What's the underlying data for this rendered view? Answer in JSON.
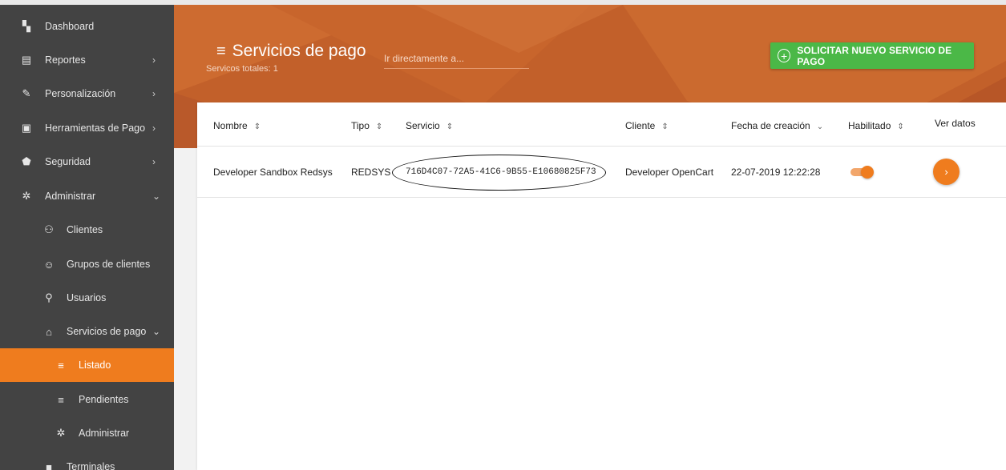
{
  "sidebar": {
    "items": [
      {
        "label": "Dashboard",
        "icon": "dashboard-icon",
        "glyph": "▚"
      },
      {
        "label": "Reportes",
        "icon": "clipboard-icon",
        "glyph": "▤",
        "chevron": "›"
      },
      {
        "label": "Personalización",
        "icon": "brush-icon",
        "glyph": "✎",
        "chevron": "›"
      },
      {
        "label": "Herramientas de Pago",
        "icon": "payment-icon",
        "glyph": "▣",
        "chevron": "›"
      },
      {
        "label": "Seguridad",
        "icon": "shield-icon",
        "glyph": "⬟",
        "chevron": "›"
      },
      {
        "label": "Administrar",
        "icon": "gear-icon",
        "glyph": "✲",
        "chevron": "⌄"
      },
      {
        "label": "Clientes",
        "icon": "people-icon",
        "glyph": "⚇"
      },
      {
        "label": "Grupos de clientes",
        "icon": "group-icon",
        "glyph": "☺"
      },
      {
        "label": "Usuarios",
        "icon": "user-icon",
        "glyph": "⚲"
      },
      {
        "label": "Servicios de pago",
        "icon": "bank-icon",
        "glyph": "⌂",
        "chevron": "⌄"
      },
      {
        "label": "Listado",
        "icon": "list-icon",
        "glyph": "≡"
      },
      {
        "label": "Pendientes",
        "icon": "list-icon",
        "glyph": "≡"
      },
      {
        "label": "Administrar",
        "icon": "gear-icon",
        "glyph": "✲"
      },
      {
        "label": "Terminales",
        "icon": "briefcase-icon",
        "glyph": "■"
      }
    ]
  },
  "header": {
    "title": "Servicios de pago",
    "title_icon": "menu-icon",
    "subtitle": "Servicos totales: 1",
    "search_placeholder": "Ir directamente a...",
    "new_button": "SOLICITAR NUEVO SERVICIO DE PAGO"
  },
  "table": {
    "columns": {
      "nombre": "Nombre",
      "tipo": "Tipo",
      "servicio": "Servicio",
      "cliente": "Cliente",
      "fecha": "Fecha de creación",
      "habilitado": "Habilitado",
      "ver": "Ver datos"
    },
    "rows": [
      {
        "nombre": "Developer Sandbox Redsys",
        "tipo": "REDSYS",
        "servicio": "716D4C07-72A5-41C6-9B55-E10680825F73",
        "cliente": "Developer OpenCart",
        "fecha": "22-07-2019 12:22:28",
        "habilitado": true
      }
    ]
  },
  "colors": {
    "accent": "#ef7c1e",
    "header": "#c2602a",
    "sidebar": "#434343",
    "success": "#4bb847"
  }
}
